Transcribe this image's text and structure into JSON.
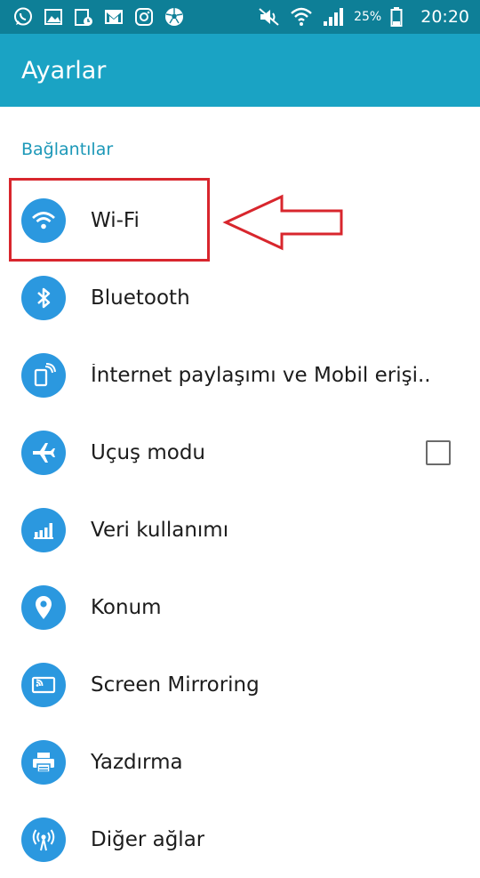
{
  "status_bar": {
    "battery": "25%",
    "time": "20:20",
    "left_icons": [
      "whatsapp-icon",
      "gallery-icon",
      "calendar-icon",
      "gmail-icon",
      "instagram-icon",
      "soccer-ball-icon"
    ],
    "right_icons": [
      "mute-icon",
      "wifi-signal-icon",
      "cell-signal-icon",
      "battery-icon"
    ]
  },
  "app_bar": {
    "title": "Ayarlar"
  },
  "section": {
    "title": "Bağlantılar"
  },
  "items": [
    {
      "label": "Wi-Fi",
      "icon": "wifi-icon"
    },
    {
      "label": "Bluetooth",
      "icon": "bluetooth-icon"
    },
    {
      "label": "İnternet paylaşımı ve Mobil erişi..",
      "icon": "tethering-icon"
    },
    {
      "label": "Uçuş modu",
      "icon": "airplane-icon",
      "checkbox_checked": false
    },
    {
      "label": "Veri kullanımı",
      "icon": "data-usage-icon"
    },
    {
      "label": "Konum",
      "icon": "location-icon"
    },
    {
      "label": "Screen Mirroring",
      "icon": "screen-mirroring-icon"
    },
    {
      "label": "Yazdırma",
      "icon": "printer-icon"
    },
    {
      "label": "Diğer ağlar",
      "icon": "other-networks-icon"
    }
  ],
  "colors": {
    "status_bar": "#0e7f97",
    "app_bar": "#1aa3c4",
    "section_header": "#1c98b8",
    "icon_circle": "#2b98df",
    "annotation": "#d8262d"
  }
}
